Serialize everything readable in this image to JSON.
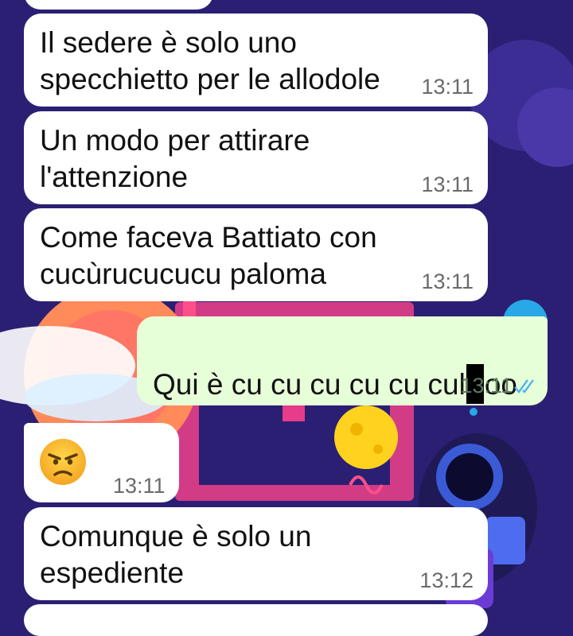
{
  "messages": [
    {
      "id": "m0",
      "direction": "incoming",
      "text": "",
      "time": ""
    },
    {
      "id": "m1",
      "direction": "incoming",
      "text": "Il sedere è solo uno\nspecchietto per le allodole",
      "time": "13:11"
    },
    {
      "id": "m2",
      "direction": "incoming",
      "text": "Un modo per attirare\nl'attenzione",
      "time": "13:11"
    },
    {
      "id": "m3",
      "direction": "incoming",
      "text": "Come faceva Battiato con\ncucùrucucucu paloma",
      "time": "13:11"
    },
    {
      "id": "m4",
      "direction": "outgoing",
      "text_before": "Qui è cu cu cu cu cu cul",
      "text_after": "oo",
      "redacted": true,
      "time": "13:11",
      "status": "read-double-check-icon"
    },
    {
      "id": "m5",
      "direction": "incoming",
      "emoji": "angry-face-emoji",
      "time": "13:11"
    },
    {
      "id": "m6",
      "direction": "incoming",
      "text": "Comunque è solo un\nespediente",
      "time": "13:12"
    }
  ],
  "colors": {
    "wallpaper": "#2a1f73",
    "incoming_bubble": "#ffffff",
    "outgoing_bubble": "#e7ffd8",
    "read_ticks": "#4fb6ec"
  }
}
